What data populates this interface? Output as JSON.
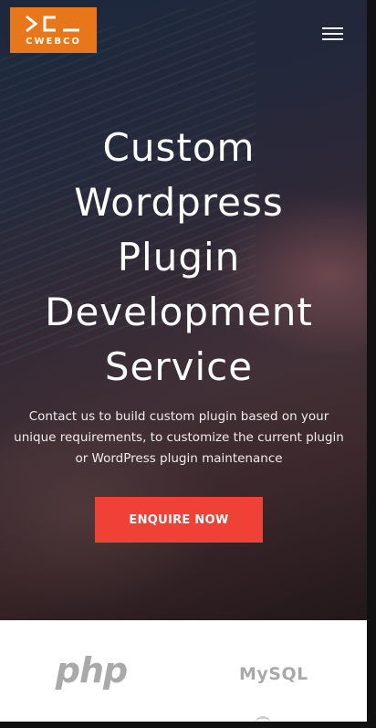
{
  "header": {
    "logo_text": "CWEBCO",
    "menu_icon": "hamburger-menu-icon",
    "brand_color": "#e8761a"
  },
  "hero": {
    "title_lines": [
      "Custom",
      "Wordpress",
      "Plugin",
      "Development",
      "Service"
    ],
    "description": "Contact us to build custom plugin based on your unique requirements, to customize the current plugin or WordPress plugin maintenance",
    "cta_label": "ENQUIRE NOW",
    "cta_color": "#ef4136"
  },
  "tech_logos": {
    "items": [
      "php",
      "MySQL"
    ]
  }
}
